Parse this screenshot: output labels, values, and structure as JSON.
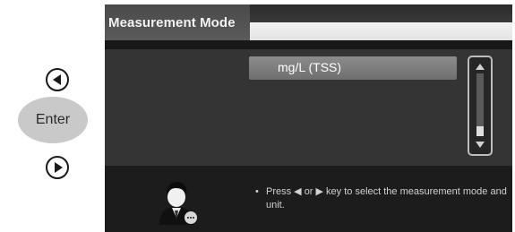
{
  "controls": {
    "left_icon": "left-arrow-circle-icon",
    "enter_label": "Enter",
    "right_icon": "right-arrow-circle-icon"
  },
  "screen": {
    "title": "Measurement Mode",
    "selected_option": "mg/L  (TSS)",
    "help": {
      "bullet": "•",
      "text": "Press ◀ or ▶ key to select the measurement mode and unit."
    },
    "scroll_position": 1.0
  },
  "colors": {
    "screen_bg": "#2a2a2a",
    "selection": "#7d7d7d",
    "title_text": "#f2f2f2"
  }
}
